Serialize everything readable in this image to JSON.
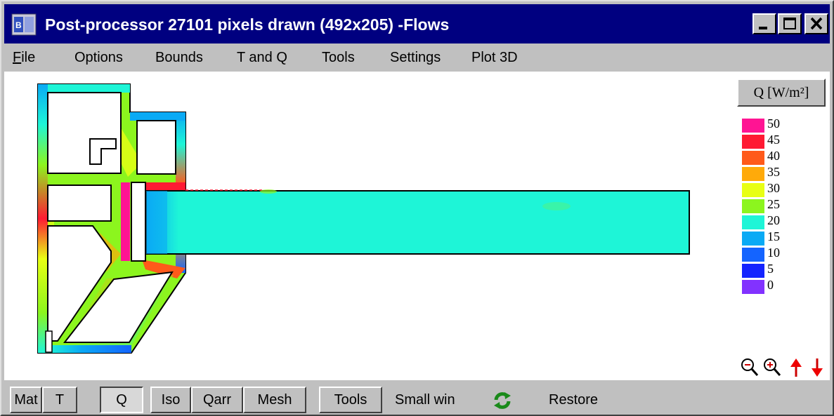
{
  "window": {
    "title": "Post-processor 27101 pixels drawn (492x205) -Flows",
    "controls": [
      "minimize-icon",
      "maximize-icon",
      "close-icon"
    ]
  },
  "menu": [
    {
      "label": "File"
    },
    {
      "label": "Options"
    },
    {
      "label": "Bounds"
    },
    {
      "label": "T and Q"
    },
    {
      "label": "Tools"
    },
    {
      "label": "Settings"
    },
    {
      "label": "Plot 3D"
    }
  ],
  "legend": {
    "title": "Q [W/m²]",
    "entries": [
      {
        "value": "50",
        "color": "#ff1493"
      },
      {
        "value": "45",
        "color": "#ff1a33"
      },
      {
        "value": "40",
        "color": "#ff5a1a"
      },
      {
        "value": "35",
        "color": "#ffaa0a"
      },
      {
        "value": "30",
        "color": "#e8ff14"
      },
      {
        "value": "25",
        "color": "#8cf51e"
      },
      {
        "value": "20",
        "color": "#1ef5d7"
      },
      {
        "value": "15",
        "color": "#0aaaf5"
      },
      {
        "value": "10",
        "color": "#1464ff"
      },
      {
        "value": "5",
        "color": "#1423ff"
      },
      {
        "value": "0",
        "color": "#8232ff"
      }
    ]
  },
  "zoom_tools": [
    "zoom-out-icon",
    "zoom-in-icon",
    "scale-up-icon",
    "scale-down-icon"
  ],
  "statusbar": {
    "mat": "Mat",
    "t": "T",
    "q": "Q",
    "iso": "Iso",
    "qarr": "Qarr",
    "mesh": "Mesh",
    "tools": "Tools",
    "small_win": "Small win",
    "restore": "Restore"
  },
  "colors": {
    "titlebar": "#000080",
    "chrome": "#c0c0c0"
  }
}
